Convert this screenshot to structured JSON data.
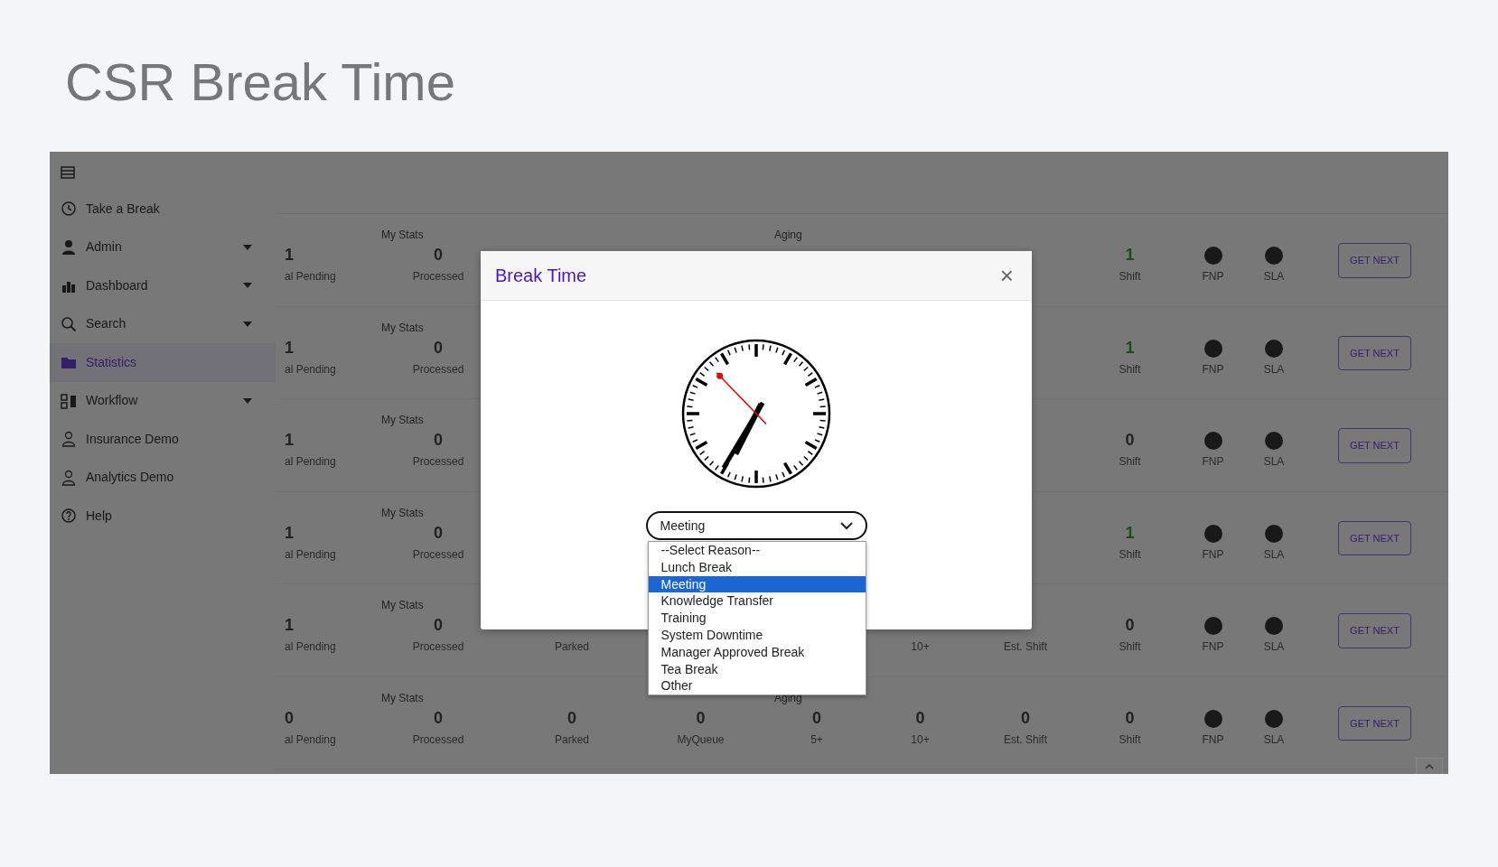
{
  "page_title": "CSR Break Time",
  "sidebar": {
    "items": [
      {
        "label": "Take a Break",
        "kind": "clock",
        "selected": false,
        "has_submenu": false
      },
      {
        "label": "Admin",
        "kind": "person",
        "selected": false,
        "has_submenu": true
      },
      {
        "label": "Dashboard",
        "kind": "chart",
        "selected": false,
        "has_submenu": true
      },
      {
        "label": "Search",
        "kind": "search",
        "selected": false,
        "has_submenu": true
      },
      {
        "label": "Statistics",
        "kind": "folder",
        "selected": true,
        "has_submenu": false
      },
      {
        "label": "Workflow",
        "kind": "workflow",
        "selected": false,
        "has_submenu": true
      },
      {
        "label": "Insurance Demo",
        "kind": "user",
        "selected": false,
        "has_submenu": false
      },
      {
        "label": "Analytics Demo",
        "kind": "user",
        "selected": false,
        "has_submenu": false
      },
      {
        "label": "Help",
        "kind": "help",
        "selected": false,
        "has_submenu": false
      }
    ]
  },
  "stat_rows": [
    {
      "groups": [
        "My Stats",
        "Aging"
      ],
      "cells": [
        {
          "kind": "pending",
          "value": "1",
          "label": "al Pending",
          "highlight": false
        },
        {
          "kind": "processed",
          "value": "0",
          "label": "Processed",
          "highlight": false
        },
        {
          "kind": "shift",
          "value": "1",
          "label": "Shift",
          "highlight": true
        }
      ],
      "indicators": [
        "FNP",
        "SLA"
      ],
      "button": "GET NEXT"
    },
    {
      "groups": [
        "My Stats"
      ],
      "cells": [
        {
          "kind": "pending",
          "value": "1",
          "label": "al Pending",
          "highlight": false
        },
        {
          "kind": "processed",
          "value": "0",
          "label": "Processed",
          "highlight": false
        },
        {
          "kind": "shift",
          "value": "1",
          "label": "Shift",
          "highlight": true
        }
      ],
      "indicators": [
        "FNP",
        "SLA"
      ],
      "button": "GET NEXT"
    },
    {
      "groups": [
        "My Stats"
      ],
      "cells": [
        {
          "kind": "pending",
          "value": "1",
          "label": "al Pending",
          "highlight": false
        },
        {
          "kind": "processed",
          "value": "0",
          "label": "Processed",
          "highlight": false
        },
        {
          "kind": "shift",
          "value": "0",
          "label": "Shift",
          "highlight": false
        }
      ],
      "indicators": [
        "FNP",
        "SLA"
      ],
      "button": "GET NEXT"
    },
    {
      "groups": [
        "My Stats"
      ],
      "cells": [
        {
          "kind": "pending",
          "value": "1",
          "label": "al Pending",
          "highlight": false
        },
        {
          "kind": "processed",
          "value": "0",
          "label": "Processed",
          "highlight": false
        },
        {
          "kind": "shift",
          "value": "1",
          "label": "Shift",
          "highlight": true
        }
      ],
      "indicators": [
        "FNP",
        "SLA"
      ],
      "button": "GET NEXT"
    },
    {
      "groups": [
        "My Stats"
      ],
      "cells": [
        {
          "kind": "pending",
          "value": "1",
          "label": "al Pending",
          "highlight": false
        },
        {
          "kind": "processed",
          "value": "0",
          "label": "Processed",
          "highlight": false
        },
        {
          "kind": "parked",
          "label": "Parked"
        },
        {
          "kind": "aging10",
          "label": "10+"
        },
        {
          "kind": "est_shift",
          "label": "Est. Shift"
        },
        {
          "kind": "shift",
          "value": "0",
          "label": "Shift",
          "highlight": false
        }
      ],
      "indicators": [
        "FNP",
        "SLA"
      ],
      "button": "GET NEXT"
    },
    {
      "groups": [
        "My Stats",
        "Aging"
      ],
      "cells": [
        {
          "kind": "pending",
          "value": "0",
          "label": "al Pending",
          "highlight": false
        },
        {
          "kind": "processed",
          "value": "0",
          "label": "Processed",
          "highlight": false
        },
        {
          "kind": "parked",
          "value": "0",
          "label": "Parked",
          "highlight": false
        },
        {
          "kind": "myqueue",
          "value": "0",
          "label": "MyQueue",
          "highlight": false
        },
        {
          "kind": "aging5",
          "value": "0",
          "label": "5+",
          "highlight": false
        },
        {
          "kind": "aging10",
          "value": "0",
          "label": "10+",
          "highlight": false
        },
        {
          "kind": "est_shift",
          "value": "0",
          "label": "Est. Shift",
          "highlight": false
        },
        {
          "kind": "shift",
          "value": "0",
          "label": "Shift",
          "highlight": false
        }
      ],
      "indicators": [
        "FNP",
        "SLA"
      ],
      "button": "GET NEXT"
    }
  ],
  "modal": {
    "title": "Break Time",
    "close": "×",
    "reason": {
      "value": "Meeting",
      "expanded": true,
      "options": [
        {
          "label": "--Select Reason--",
          "selected": false
        },
        {
          "label": "Lunch Break",
          "selected": false
        },
        {
          "label": "Meeting",
          "selected": true
        },
        {
          "label": "Knowledge Transfer",
          "selected": false
        },
        {
          "label": "Training",
          "selected": false
        },
        {
          "label": "System Downtime",
          "selected": false
        },
        {
          "label": "Manager Approved Break",
          "selected": false
        },
        {
          "label": "Tea Break",
          "selected": false
        },
        {
          "label": "Other",
          "selected": false
        }
      ]
    }
  }
}
